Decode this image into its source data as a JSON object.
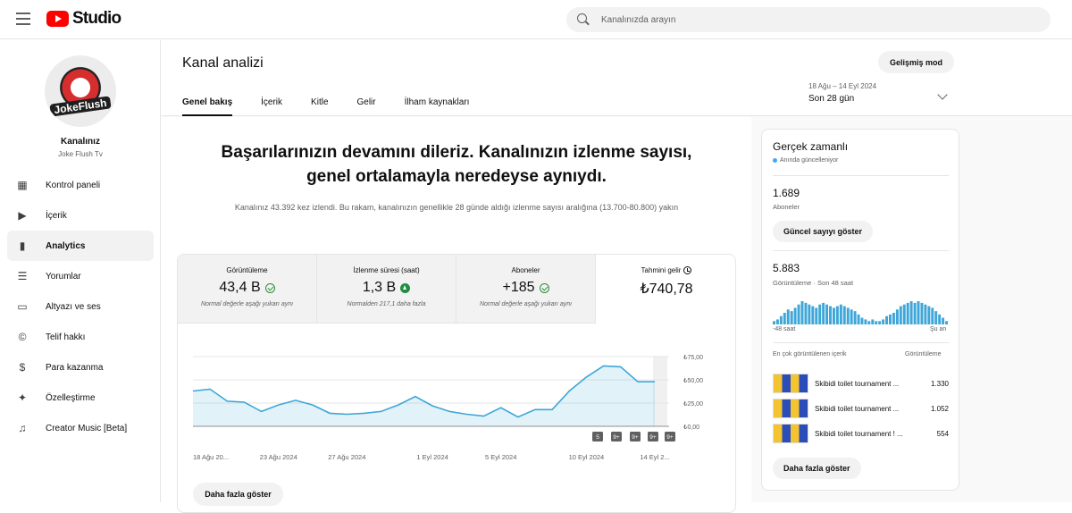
{
  "header": {
    "logo_text": "Studio",
    "search_placeholder": "Kanalınızda arayın"
  },
  "sidebar": {
    "avatar_text": "JokeFlush",
    "channel_label": "Kanalınız",
    "channel_name": "Joke Flush Tv",
    "items": [
      {
        "label": "Kontrol paneli",
        "icon": "dashboard-icon"
      },
      {
        "label": "İçerik",
        "icon": "content-icon"
      },
      {
        "label": "Analytics",
        "icon": "analytics-icon"
      },
      {
        "label": "Yorumlar",
        "icon": "comments-icon"
      },
      {
        "label": "Altyazı ve ses",
        "icon": "subtitles-icon"
      },
      {
        "label": "Telif hakkı",
        "icon": "copyright-icon"
      },
      {
        "label": "Para kazanma",
        "icon": "dollar-icon"
      },
      {
        "label": "Özelleştirme",
        "icon": "wand-icon"
      },
      {
        "label": "Creator Music [Beta]",
        "icon": "music-icon"
      }
    ]
  },
  "page": {
    "title": "Kanal analizi",
    "advanced_button": "Gelişmiş mod",
    "tabs": [
      "Genel bakış",
      "İçerik",
      "Kitle",
      "Gelir",
      "İlham kaynakları"
    ],
    "date_range": "18 Ağu – 14 Eyl 2024",
    "date_label": "Son 28 gün"
  },
  "overview": {
    "headline": "Başarılarınızın devamını dileriz. Kanalınızın izlenme sayısı, genel ortalamayla neredeyse aynıydı.",
    "description": "Kanalınız 43.392 kez izlendi. Bu rakam, kanalınızın genellikle 28 günde aldığı izlenme sayısı aralığına (13.700-80.800) yakın",
    "more_button": "Daha fazla göster"
  },
  "metrics": [
    {
      "title": "Görüntüleme",
      "value": "43,4 B",
      "note": "Normal değerle aşağı yukarı aynı",
      "status": "ok"
    },
    {
      "title": "İzlenme süresi (saat)",
      "value": "1,3 B",
      "note": "Normalden 217,1 daha fazla",
      "status": "up"
    },
    {
      "title": "Aboneler",
      "value": "+185",
      "note": "Normal değerle aşağı yukarı aynı",
      "status": "ok"
    },
    {
      "title": "Tahmini gelir",
      "value": "₺740,78",
      "note": "",
      "status": "clock"
    }
  ],
  "chart_data": {
    "type": "area",
    "x": [
      "18 Ağu",
      "19 Ağu",
      "20 Ağu",
      "21 Ağu",
      "22 Ağu",
      "23 Ağu",
      "24 Ağu",
      "25 Ağu",
      "26 Ağu",
      "27 Ağu",
      "28 Ağu",
      "29 Ağu",
      "30 Ağu",
      "31 Ağu",
      "1 Eyl",
      "2 Eyl",
      "3 Eyl",
      "4 Eyl",
      "5 Eyl",
      "6 Eyl",
      "7 Eyl",
      "8 Eyl",
      "9 Eyl",
      "10 Eyl",
      "11 Eyl",
      "12 Eyl",
      "13 Eyl",
      "14 Eyl"
    ],
    "x_tick_labels": [
      "18 Ağu 20...",
      "23 Ağu 2024",
      "27 Ağu 2024",
      "1 Eyl 2024",
      "5 Eyl 2024",
      "10 Eyl 2024",
      "14 Eyl 2..."
    ],
    "x_tick_index": [
      0,
      5,
      9,
      14,
      18,
      23,
      27
    ],
    "y_tick_labels": [
      "₺75,00",
      "₺50,00",
      "₺25,00",
      "₺0,00"
    ],
    "ylim": [
      0,
      75
    ],
    "values": [
      38,
      40,
      27,
      26,
      16,
      23,
      28,
      23,
      14,
      13,
      14,
      16,
      23,
      32,
      22,
      16,
      13,
      11,
      20,
      10,
      18,
      18,
      38,
      53,
      65,
      64,
      48,
      48
    ],
    "markers": [
      "5",
      "9+",
      "9+",
      "9+",
      "9+"
    ],
    "grid": true,
    "color": "#3ea6d8"
  },
  "realtime": {
    "title": "Gerçek zamanlı",
    "live": "Anında güncelleniyor",
    "subscribers": "1.689",
    "subscribers_label": "Aboneler",
    "show_count_button": "Güncel sayıyı göster",
    "views": "5.883",
    "views_label": "Görüntüleme · Son 48 saat",
    "spark_start": "-48 saat",
    "spark_end": "Şu an",
    "spark_values": [
      2,
      3,
      5,
      7,
      9,
      8,
      10,
      12,
      14,
      13,
      12,
      11,
      10,
      12,
      13,
      12,
      11,
      10,
      11,
      12,
      11,
      10,
      9,
      8,
      6,
      4,
      3,
      2,
      3,
      2,
      2,
      3,
      5,
      6,
      7,
      9,
      11,
      12,
      13,
      14,
      13,
      14,
      13,
      12,
      11,
      10,
      8,
      6,
      4,
      2
    ],
    "top_label": "En çok görüntülenen içerik",
    "top_col": "Görüntüleme",
    "top_items": [
      {
        "title": "Skibidi toilet tournament ...",
        "views": "1.330"
      },
      {
        "title": "Skibidi toilet tournament ...",
        "views": "1.052"
      },
      {
        "title": "Skibidi toilet tournament ! ...",
        "views": "554"
      }
    ],
    "more_button": "Daha fazla göster"
  }
}
